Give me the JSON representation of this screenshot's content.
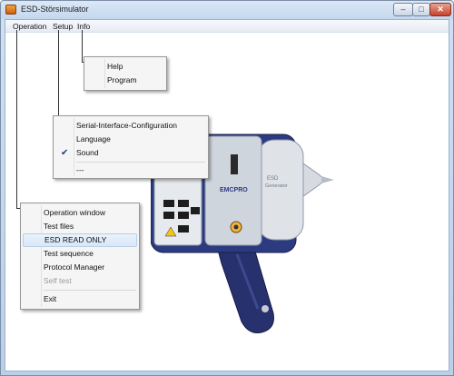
{
  "window": {
    "title": "ESD-Störsimulator"
  },
  "title_buttons": {
    "minimize": "–",
    "maximize": "□",
    "close": "✕"
  },
  "menubar": {
    "operation": "Operation",
    "setup": "Setup",
    "info": "Info"
  },
  "info_menu": {
    "items": [
      "Help",
      "Program"
    ]
  },
  "setup_menu": {
    "items": [
      "Serial-Interface-Configuration",
      "Language",
      "Sound",
      "---"
    ],
    "checked": "Sound"
  },
  "operation_menu": {
    "items": [
      "Operation window",
      "Test files",
      "ESD READ ONLY",
      "Test sequence",
      "Protocol Manager",
      "Self test",
      "Exit"
    ],
    "highlighted": "ESD READ ONLY",
    "disabled": "Self test"
  },
  "device": {
    "brand": "EMCPRO",
    "label_line1": "ESD",
    "label_line2": "Generator"
  },
  "colors": {
    "device_body": "#2a3575",
    "device_panel": "#d9dee3",
    "highlight": "#d9e7f8"
  }
}
